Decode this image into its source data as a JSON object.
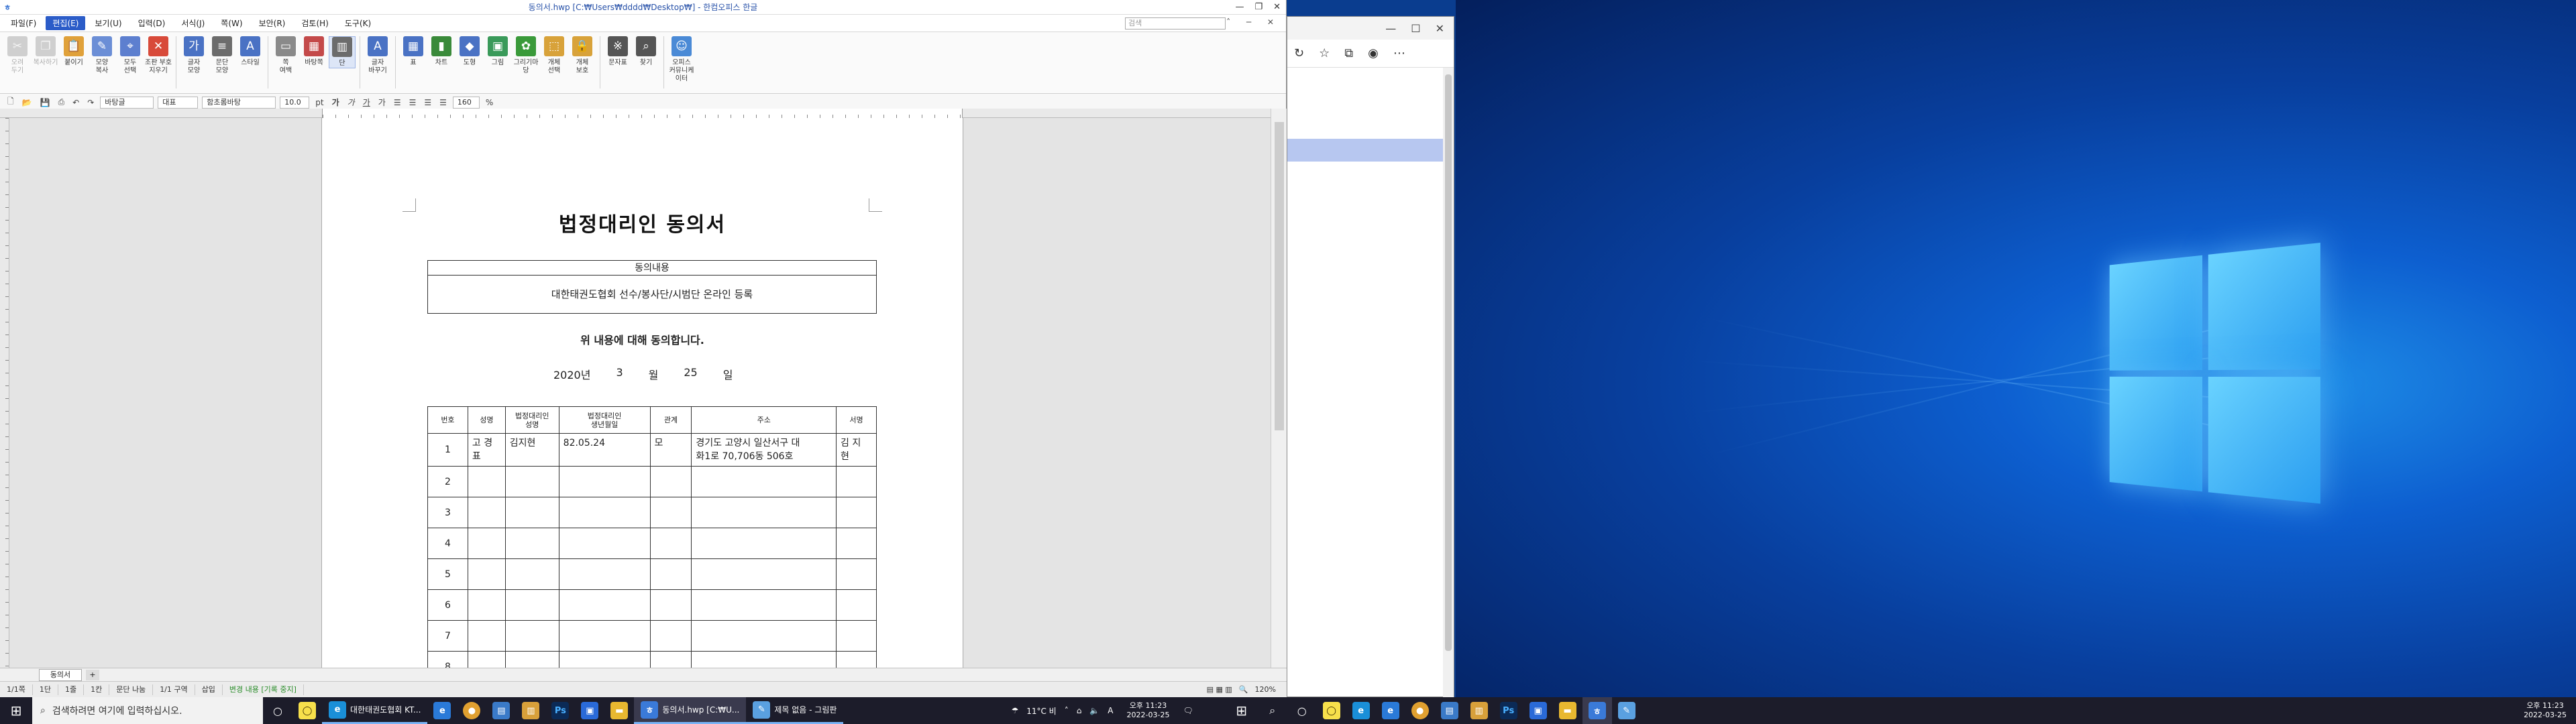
{
  "hwp": {
    "window_title": "동의서.hwp [C:₩Users₩dddd₩Desktop₩] - 한컴오피스 한글",
    "menu": [
      "파일(F)",
      "편집(E)",
      "보기(U)",
      "입력(D)",
      "서식(J)",
      "쪽(W)",
      "보안(R)",
      "검토(H)",
      "도구(K)"
    ],
    "search_placeholder": "검색",
    "ribbon": [
      {
        "label": "오려\n두기",
        "icon": "scissors-icon",
        "glyph": "✂",
        "color": "#cfcfcf",
        "dim": true
      },
      {
        "label": "복사하기",
        "icon": "copy-icon",
        "glyph": "❐",
        "color": "#cfcfcf",
        "dim": true
      },
      {
        "label": "붙이기",
        "icon": "paste-icon",
        "glyph": "📋",
        "color": "#e0a13a",
        "dim": false
      },
      {
        "label": "모양\n복사",
        "icon": "format-painter-icon",
        "glyph": "✎",
        "color": "#6b8ed6",
        "dim": false
      },
      {
        "label": "모두\n선택",
        "icon": "select-all-icon",
        "glyph": "⌖",
        "color": "#5d7fcf",
        "dim": false
      },
      {
        "label": "조판 부호\n지우기",
        "icon": "clear-format-icon",
        "glyph": "✕",
        "color": "#d84a3a",
        "dim": false
      },
      {
        "label": "글자\n모양",
        "icon": "char-shape-icon",
        "glyph": "가",
        "color": "#4a72c4",
        "dim": false
      },
      {
        "label": "문단\n모양",
        "icon": "paragraph-shape-icon",
        "glyph": "≡",
        "color": "#6c6c6c",
        "dim": false
      },
      {
        "label": "스타일",
        "icon": "style-icon",
        "glyph": "A",
        "color": "#4a72c4",
        "dim": false
      },
      {
        "label": "쪽\n여백",
        "icon": "page-margin-icon",
        "glyph": "▭",
        "color": "#8a8a8a",
        "dim": false
      },
      {
        "label": "바탕쪽",
        "icon": "master-page-icon",
        "glyph": "▦",
        "color": "#c44a4a",
        "dim": false
      },
      {
        "label": "단",
        "icon": "columns-icon",
        "glyph": "▥",
        "color": "#6c6c6c",
        "dim": false
      },
      {
        "label": "글자\n바꾸기",
        "icon": "replace-icon",
        "glyph": "A",
        "color": "#4a72c4",
        "dim": false
      },
      {
        "label": "표",
        "icon": "table-icon",
        "glyph": "▦",
        "color": "#4a72c4",
        "dim": false
      },
      {
        "label": "차트",
        "icon": "chart-icon",
        "glyph": "▮",
        "color": "#3a8a3a",
        "dim": false
      },
      {
        "label": "도형",
        "icon": "shape-icon",
        "glyph": "◆",
        "color": "#4a72c4",
        "dim": false
      },
      {
        "label": "그림",
        "icon": "picture-icon",
        "glyph": "▣",
        "color": "#3a9a5a",
        "dim": false
      },
      {
        "label": "그리기마당",
        "icon": "clipart-icon",
        "glyph": "✿",
        "color": "#3a9a3a",
        "dim": false
      },
      {
        "label": "개체\n선택",
        "icon": "object-select-icon",
        "glyph": "⬚",
        "color": "#d8a23a",
        "dim": false
      },
      {
        "label": "개체\n보호",
        "icon": "object-protect-icon",
        "glyph": "🔒",
        "color": "#d8a23a",
        "dim": false
      },
      {
        "label": "문자표",
        "icon": "symbol-icon",
        "glyph": "※",
        "color": "#555555",
        "dim": false
      },
      {
        "label": "찾기",
        "icon": "find-icon",
        "glyph": "⌕",
        "color": "#555555",
        "dim": false
      },
      {
        "label": "오피스\n커뮤니케이터",
        "icon": "communicator-icon",
        "glyph": "☺",
        "color": "#4a8ad6",
        "dim": false
      }
    ],
    "format": {
      "style": "바탕글",
      "lang": "대표",
      "font": "함초롬바탕",
      "size": "10.0",
      "unit": "pt",
      "zoom": "160",
      "percent": "%"
    },
    "document": {
      "title": "법정대리인 동의서",
      "consent_header": "동의내용",
      "consent_body": "대한태권도협회 선수/봉사단/시범단 온라인 등록",
      "agree_line": "위 내용에 대해 동의합니다.",
      "date": {
        "year": "2020년",
        "month_num": "3",
        "month": "월",
        "day_num": "25",
        "day": "일"
      },
      "table_headers": [
        "번호",
        "성명",
        "법정대리인\n성명",
        "법정대리인\n생년월일",
        "관계",
        "주소",
        "서명"
      ],
      "rows": [
        [
          "1",
          "고 경\n표",
          "김지현",
          "82.05.24",
          "모",
          "경기도 고양시 일산서구 대\n화1로 70,706동 506호",
          "김 지\n현"
        ],
        [
          "2",
          "",
          "",
          "",
          "",
          "",
          ""
        ],
        [
          "3",
          "",
          "",
          "",
          "",
          "",
          ""
        ],
        [
          "4",
          "",
          "",
          "",
          "",
          "",
          ""
        ],
        [
          "5",
          "",
          "",
          "",
          "",
          "",
          ""
        ],
        [
          "6",
          "",
          "",
          "",
          "",
          "",
          ""
        ],
        [
          "7",
          "",
          "",
          "",
          "",
          "",
          ""
        ],
        [
          "8",
          "",
          "",
          "",
          "",
          "",
          ""
        ]
      ]
    },
    "sheet_tab": "동의서",
    "status": [
      "1/1쪽",
      "1단",
      "1줄",
      "1칸",
      "문단 나눔",
      "1/1 구역",
      "삽입",
      "변경 내용 [기록 중지]"
    ],
    "status_zoom": "120%"
  },
  "taskbar": {
    "search_placeholder": "검색하려면 여기에 입력하십시오.",
    "apps": [
      {
        "label": "대한태권도협회 KT..."
      },
      {
        "label": "동의서.hwp [C:₩U..."
      },
      {
        "label": "제목 없음 - 그림판"
      }
    ],
    "weather": "11°C 비",
    "ime": "A",
    "time": "오후 11:23",
    "date": "2022-03-25",
    "time2": "오후 11:23",
    "date2": "2022-03-25"
  }
}
